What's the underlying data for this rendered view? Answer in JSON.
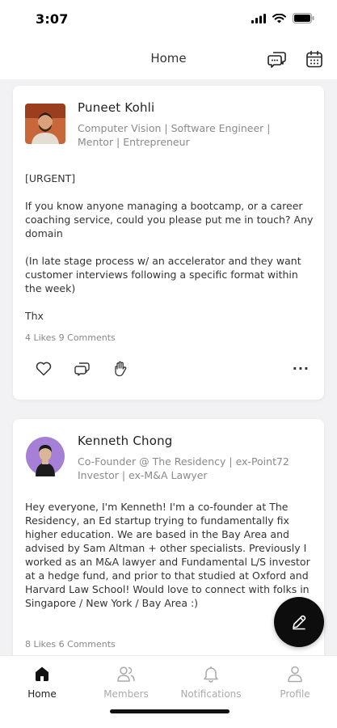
{
  "status": {
    "time": "3:07"
  },
  "header": {
    "title": "Home"
  },
  "posts": [
    {
      "author": "Puneet Kohli",
      "headline": "Computer Vision | Software Engineer | Mentor | Entrepreneur",
      "body": "[URGENT]\n\nIf you know anyone managing a bootcamp, or a career coaching service, could you please put me in touch? Any domain\n\n(In late stage process w/ an accelerator and they want customer interviews following a specific format within the week)\n\nThx",
      "stats": "4 Likes  9 Comments"
    },
    {
      "author": "Kenneth Chong",
      "headline": "Co-Founder @ The Residency | ex-Point72 Investor | ex-M&A Lawyer",
      "body": "Hey everyone, I'm Kenneth! I'm a co-founder at The Residency, an Ed startup trying to fundamentally fix higher education. We are based in the Bay Area and advised by Sam Altman + other specialists. Previously I worked as an M&A lawyer and Fundamental L/S investor at a hedge fund, and prior to that studied at Oxford and Harvard Law School! Would love to connect with folks in Singapore / New York / Bay Area :)",
      "stats": "8 Likes  6 Comments"
    }
  ],
  "tabs": {
    "home": "Home",
    "members": "Members",
    "notifications": "Notifications",
    "profile": "Profile"
  },
  "icons": {
    "chat": "chat-bubbles-icon",
    "calendar": "calendar-icon",
    "like": "heart-icon",
    "comment": "comment-icon",
    "wave": "hand-wave-icon",
    "more": "more-dots-icon",
    "compose": "pencil-icon"
  },
  "colors": {
    "accent": "#111111",
    "muted": "#8a8a8a"
  }
}
